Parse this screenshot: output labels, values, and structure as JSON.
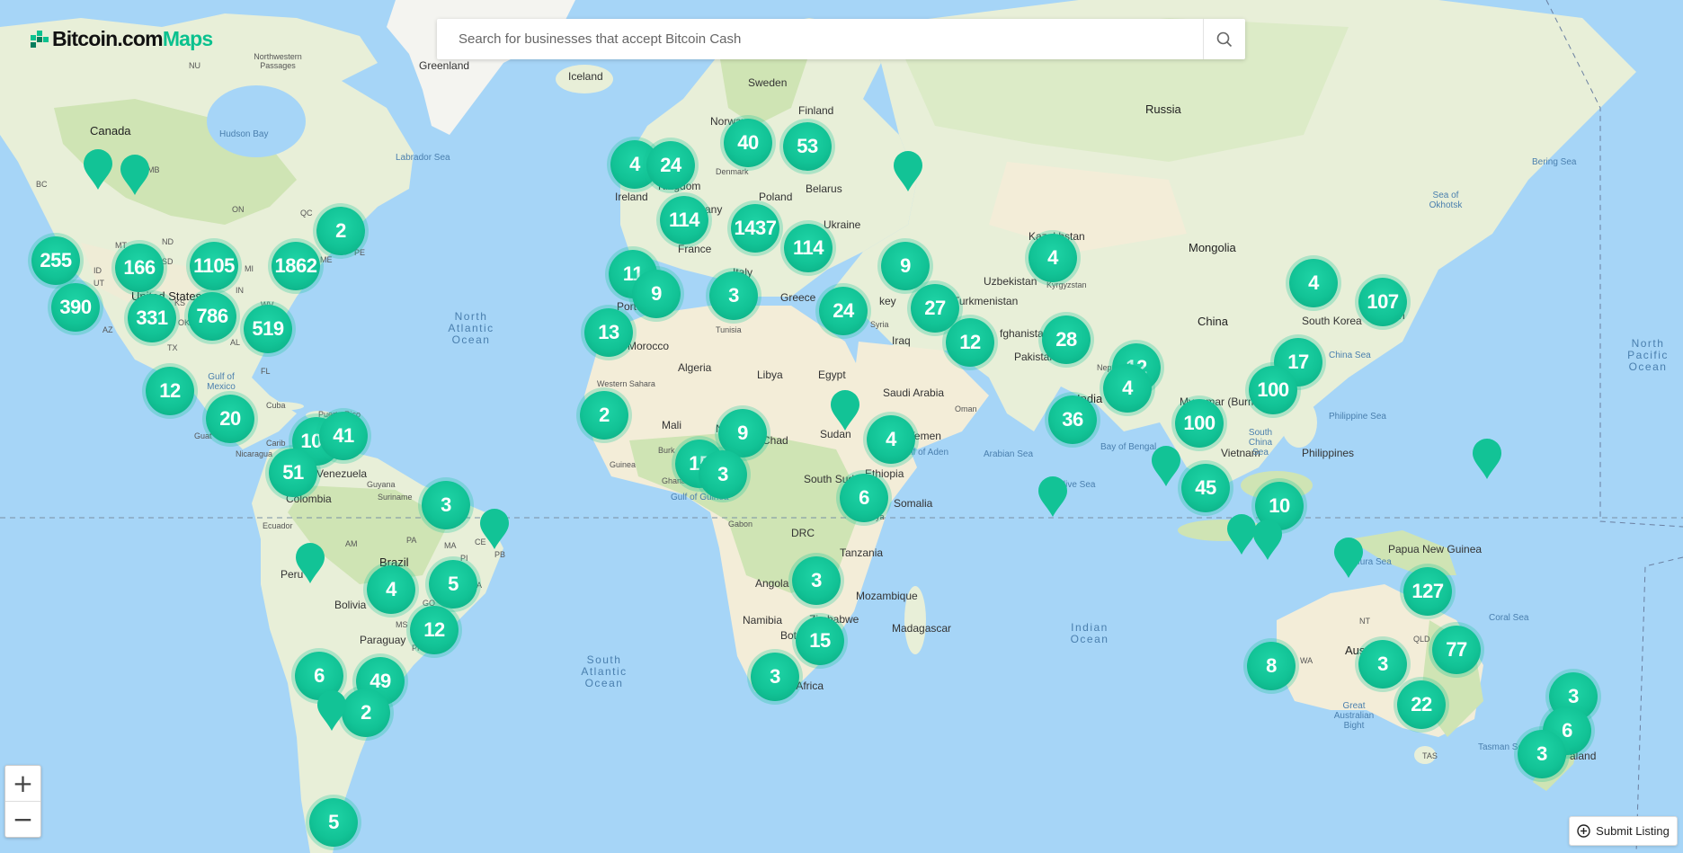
{
  "app": {
    "brand_part1": "Bitcoin.com",
    "brand_part2": "Maps",
    "brand_color": "#0ac18e"
  },
  "search": {
    "placeholder": "Search for businesses that accept Bitcoin Cash",
    "icon": "search-icon"
  },
  "controls": {
    "zoom_in": "+",
    "zoom_out": "−",
    "submit_listing": "Submit Listing",
    "submit_icon": "plus-circle-icon"
  },
  "colors": {
    "water": "#a6d5f7",
    "land": "#e8efd8",
    "forest": "#cfe4b4",
    "desert": "#f3edd8",
    "marker": "#12c396"
  },
  "clusters": [
    "255",
    "166",
    "1105",
    "1862",
    "2",
    "390",
    "331",
    "786",
    "519",
    "12",
    "20",
    "108",
    "41",
    "51",
    "3",
    "4",
    "5",
    "12",
    "6",
    "49",
    "2",
    "5",
    "4",
    "24",
    "40",
    "53",
    "114",
    "1437",
    "114",
    "11",
    "9",
    "3",
    "13",
    "2",
    "9",
    "15",
    "3",
    "24",
    "9",
    "27",
    "4",
    "12",
    "28",
    "4",
    "12",
    "4",
    "36",
    "100",
    "17",
    "107",
    "4",
    "6",
    "3",
    "3",
    "15",
    "100",
    "45",
    "10",
    "127",
    "77",
    "8",
    "3",
    "22",
    "3",
    "6",
    "3"
  ],
  "labels": {
    "canada": "Canada",
    "united_states": "United States",
    "greenland": "Greenland",
    "iceland": "Iceland",
    "norway": "Norway",
    "sweden": "Sweden",
    "finland": "Finland",
    "russia": "Russia",
    "ireland": "Ireland",
    "kingdom": "Kingdom",
    "denmark": "Denmark",
    "poland": "Poland",
    "germany": "Germany",
    "belarus": "Belarus",
    "ukraine": "Ukraine",
    "france": "France",
    "italy": "Italy",
    "greece": "Greece",
    "portugal": "Portu",
    "kazakhstan": "Kazakhstan",
    "mongolia": "Mongolia",
    "uzbekistan": "Uzbekistan",
    "kyrgyzstan": "Kyrgyzstan",
    "turkmenistan": "Turkmenistan",
    "afghanistan": "fghanistan",
    "pakistan": "Pakistan",
    "china": "China",
    "south_korea": "South Korea",
    "japan": "n",
    "nepal": "Nepal",
    "india": "India",
    "myanmar": "Myanmar (Burm",
    "vietnam": "Vietnam",
    "philippines": "Philippines",
    "turkey": "key",
    "syria": "Syria",
    "iraq": "Iraq",
    "iran": "I",
    "saudi_arabia": "Saudi Arabia",
    "yemen": "Yemen",
    "oman": "Oman",
    "morocco": "Morocco",
    "algeria": "Algeria",
    "libya": "Libya",
    "egypt": "Egypt",
    "tunisia": "Tunisia",
    "western_sahara": "Western Sahara",
    "mauritania": "ania",
    "mali": "Mali",
    "niger": "Ni",
    "chad": "Chad",
    "sudan": "Sudan",
    "south_sudan": "South Sudan",
    "ethiopia": "Ethiopia",
    "somalia": "Somalia",
    "kenya": "ya",
    "burkina": "Burk",
    "guinea": "Guinea",
    "ghana": "Ghana",
    "gabon": "Gabon",
    "drc": "DRC",
    "tanzania": "Tanzania",
    "angola": "Angola",
    "mozambique": "Mozambique",
    "zimbabwe": "Zimbabwe",
    "namibia": "Namibia",
    "botswana": "Bots",
    "madagascar": "Madagascar",
    "south_africa": "h Africa",
    "cuba": "Cuba",
    "puerto_rico": "Puerto Rico",
    "guatemala": "Guat",
    "nicaragua": "Nicaragua",
    "caribbean": "Carib",
    "venezuela": "Venezuela",
    "guyana": "Guyana",
    "suriname": "Suriname",
    "colombia": "Colombia",
    "ecuador": "Ecuador",
    "peru": "Peru",
    "brazil": "Brazil",
    "bolivia": "Bolivia",
    "paraguay": "Paraguay",
    "papua_new_guinea": "Papua New Guinea",
    "australia": "Austr",
    "new_zealand": "w aland",
    "banda_sea": "Banda",
    "arafura_sea": "fura Sea",
    "coral_sea": "Coral Sea",
    "tasman_sea": "Tasman Se",
    "great_australian_bight": "Great Australian Bight",
    "north_atlantic": "North Atlantic Ocean",
    "south_atlantic": "South Atlantic Ocean",
    "indian_ocean": "Indian Ocean",
    "north_pacific": "North Pacific Ocean",
    "hudson_bay": "Hudson Bay",
    "labrador_sea": "Labrador Sea",
    "gulf_mexico": "Gulf of Mexico",
    "gulf_guinea": "Gulf of Guinea",
    "gulf_aden": "Gulf of Aden",
    "arabian_sea": "Arabian Sea",
    "bay_bengal": "Bay of Bengal",
    "south_china_sea": "South China Sea",
    "philippine_sea": "Philippine Sea",
    "bering_sea": "Bering Sea",
    "sea_okhotsk": "Sea of Okhotsk",
    "maldives": "adive Sea",
    "china_sea": "China Sea",
    "northwestern_passages": "Northwestern Passages",
    "nu": "NU",
    "bc": "BC",
    "mb": "MB",
    "on": "ON",
    "qc": "QC",
    "mt": "MT",
    "nd": "ND",
    "sd": "SD",
    "ut": "UT",
    "az": "AZ",
    "tx": "TX",
    "ok": "OK",
    "ks": "KS",
    "mi": "MI",
    "in": "IN",
    "wv": "WV",
    "al": "AL",
    "fl": "FL",
    "me": "ME",
    "pe": "PE",
    "id": "ID",
    "am": "AM",
    "pa": "PA",
    "ma": "MA",
    "ce": "CE",
    "pi": "PI",
    "pb": "PB",
    "go": "GO",
    "ms": "MS",
    "pr": "PR",
    "ba": "BA",
    "nt": "NT",
    "qld": "QLD",
    "wa": "WA",
    "tas": "TAS"
  }
}
